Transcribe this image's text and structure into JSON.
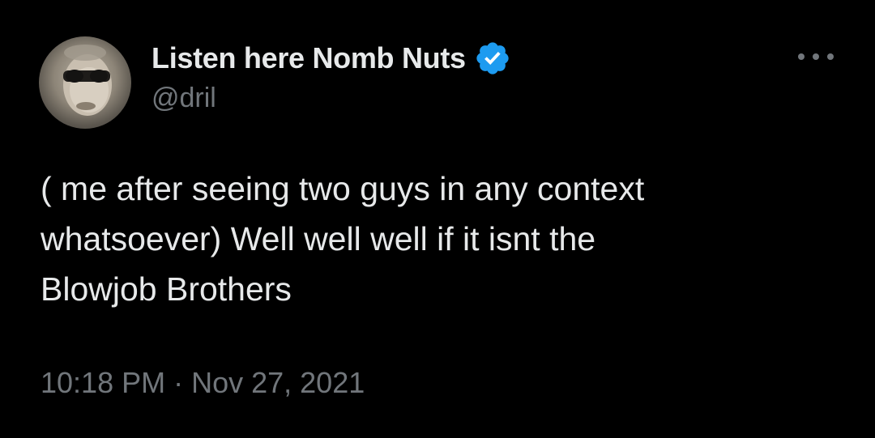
{
  "author": {
    "display_name": "Listen here Nomb Nuts",
    "handle": "@dril",
    "verified": true,
    "verified_color": "#1d9bf0",
    "avatar_icon": "profile-photo"
  },
  "tweet": {
    "lines": [
      "( me after seeing two guys in any context",
      "whatsoever) Well well well if it isnt the",
      "Blowjob Brothers"
    ]
  },
  "meta": {
    "time": "10:18 PM",
    "separator": "·",
    "date": "Nov 27, 2021"
  },
  "menu": {
    "icon": "more-horizontal-icon"
  },
  "colors": {
    "background": "#000000",
    "text": "#e7e9ea",
    "secondary": "#71767b"
  }
}
